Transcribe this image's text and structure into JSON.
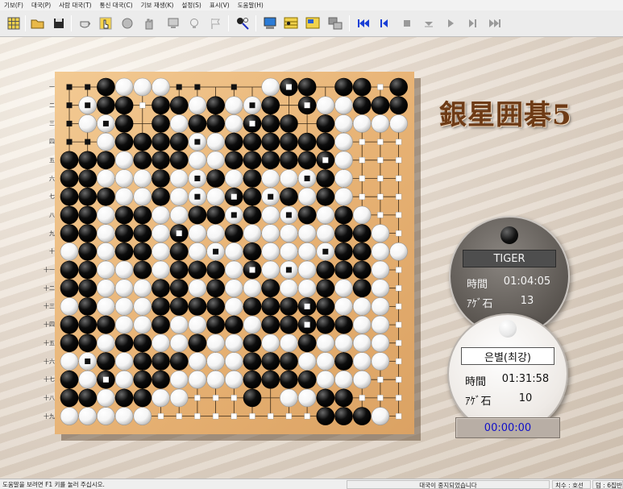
{
  "menu": [
    "기보(F)",
    "대국(P)",
    "사람 대국(T)",
    "통신 대국(C)",
    "기보 재생(K)",
    "설정(S)",
    "표시(V)",
    "도움말(H)"
  ],
  "toolbar": {
    "icons": [
      "grid-icon",
      "open-folder-icon",
      "save-disk-icon",
      "teacup-icon",
      "hand-pointer-icon",
      "stone-icon",
      "stop-hand-icon",
      "monitor-icon",
      "lightbulb-icon",
      "flag-icon",
      "magic-wand-icon",
      "computer-icon",
      "board-analysis-icon",
      "board-score-icon",
      "windows-icon",
      "first-move-icon",
      "prev-move-icon",
      "stop-icon",
      "step-down-icon",
      "play-icon",
      "next-icon",
      "last-move-icon"
    ],
    "accent": "#1a3fd6"
  },
  "logo": "銀星囲碁5",
  "board": {
    "size": 19,
    "col_labels": [
      "1",
      "2",
      "3",
      "4",
      "5",
      "6",
      "7",
      "8",
      "9",
      "10",
      "11",
      "12",
      "13",
      "14",
      "15",
      "16",
      "17",
      "18",
      "19"
    ],
    "row_labels": [
      "一",
      "二",
      "三",
      "四",
      "五",
      "六",
      "七",
      "八",
      "九",
      "十",
      "十一",
      "十二",
      "十三",
      "十四",
      "十五",
      "十六",
      "十七",
      "十八",
      "十九"
    ],
    "rows": [
      "EEBWWWEEEEEWBBEBBEB",
      "EWBBEBBWBWWBEBWWBBB",
      "EWWBEBWBBWBBBEBWWWW",
      "EEWBBBBWWBBBBBBWEEE",
      "BBBWBBBWWBBBBBBWEEE",
      "BBWWWBWWBWBWWWBWEEE",
      "BBBWWBWWWBBWBWBWEEE",
      "BBWBBWWBBWBWWBWBWEE",
      "BBWBBWBWWBWWWWWBBWE",
      "WBWBBWBWWWBWWWWBBWW",
      "BBWWBWBBBWBWWWBBBWE",
      "BBWWWBBWBWWBWWBWBWE",
      "WBWWWBBBBWBBBBBWWWE",
      "BBBWWBWWBBWBBBBBWWE",
      "BBWBBWWBWWBWWBWWWWE",
      "WWBWBBBWWWBBBWWBWWE",
      "BWBWBBWWWWBBBBWWWEE",
      "BBWBBWWEEEBEWWBBEEE",
      "WWWWWEEEEEEEEEBBBWE"
    ],
    "territory": {
      "black": [
        [
          0,
          0
        ],
        [
          0,
          1
        ],
        [
          0,
          3
        ],
        [
          0,
          7
        ],
        [
          0,
          9
        ],
        [
          1,
          0
        ],
        [
          2,
          0
        ],
        [
          3,
          0
        ],
        [
          3,
          1
        ],
        [
          0,
          6
        ]
      ],
      "white": [
        [
          0,
          16
        ],
        [
          3,
          16
        ],
        [
          3,
          17
        ],
        [
          3,
          18
        ],
        [
          4,
          16
        ],
        [
          4,
          17
        ],
        [
          4,
          18
        ],
        [
          5,
          16
        ],
        [
          5,
          17
        ],
        [
          5,
          18
        ],
        [
          6,
          16
        ],
        [
          6,
          17
        ],
        [
          6,
          18
        ],
        [
          7,
          17
        ],
        [
          7,
          18
        ],
        [
          8,
          18
        ],
        [
          10,
          18
        ],
        [
          11,
          18
        ],
        [
          12,
          18
        ],
        [
          13,
          18
        ],
        [
          14,
          18
        ],
        [
          15,
          18
        ],
        [
          16,
          17
        ],
        [
          16,
          18
        ],
        [
          17,
          7
        ],
        [
          17,
          8
        ],
        [
          17,
          9
        ],
        [
          17,
          16
        ],
        [
          17,
          17
        ],
        [
          17,
          18
        ],
        [
          18,
          5
        ],
        [
          18,
          6
        ],
        [
          18,
          7
        ],
        [
          18,
          8
        ],
        [
          18,
          9
        ],
        [
          18,
          10
        ],
        [
          18,
          11
        ],
        [
          18,
          12
        ],
        [
          18,
          13
        ],
        [
          18,
          18
        ],
        [
          0,
          17
        ],
        [
          1,
          4
        ]
      ]
    },
    "dead_marks": [
      [
        0,
        12
      ],
      [
        1,
        1
      ],
      [
        1,
        10
      ],
      [
        2,
        2
      ],
      [
        2,
        10
      ],
      [
        3,
        1
      ],
      [
        4,
        14
      ],
      [
        5,
        7
      ],
      [
        6,
        7
      ],
      [
        6,
        9
      ],
      [
        6,
        11
      ],
      [
        7,
        9
      ],
      [
        8,
        6
      ],
      [
        9,
        8
      ],
      [
        9,
        14
      ],
      [
        10,
        10
      ],
      [
        10,
        12
      ],
      [
        12,
        13
      ],
      [
        13,
        13
      ],
      [
        15,
        1
      ],
      [
        16,
        2
      ],
      [
        1,
        13
      ],
      [
        3,
        7
      ],
      [
        5,
        13
      ],
      [
        7,
        12
      ]
    ],
    "colors": {
      "black_stone": "#0d0d0d",
      "white_stone": "#f5f5f5",
      "line": "#3a2a18"
    }
  },
  "black_player": {
    "name": "TIGER",
    "time_label": "時間",
    "time": "01:04:05",
    "captures_label": "ｱｹﾞ石",
    "captures": "13"
  },
  "white_player": {
    "name": "은별(최강)",
    "time_label": "時間",
    "time": "01:31:58",
    "captures_label": "ｱｹﾞ石",
    "captures": "10"
  },
  "elapsed": "00:00:00",
  "status": {
    "hint": "도움말을 보려면 F1 키를 눌러 주십시오.",
    "game_state": "대국이 중지되었습니다",
    "move_count": "치수 : 호선",
    "score": "덤 : 6집반"
  }
}
